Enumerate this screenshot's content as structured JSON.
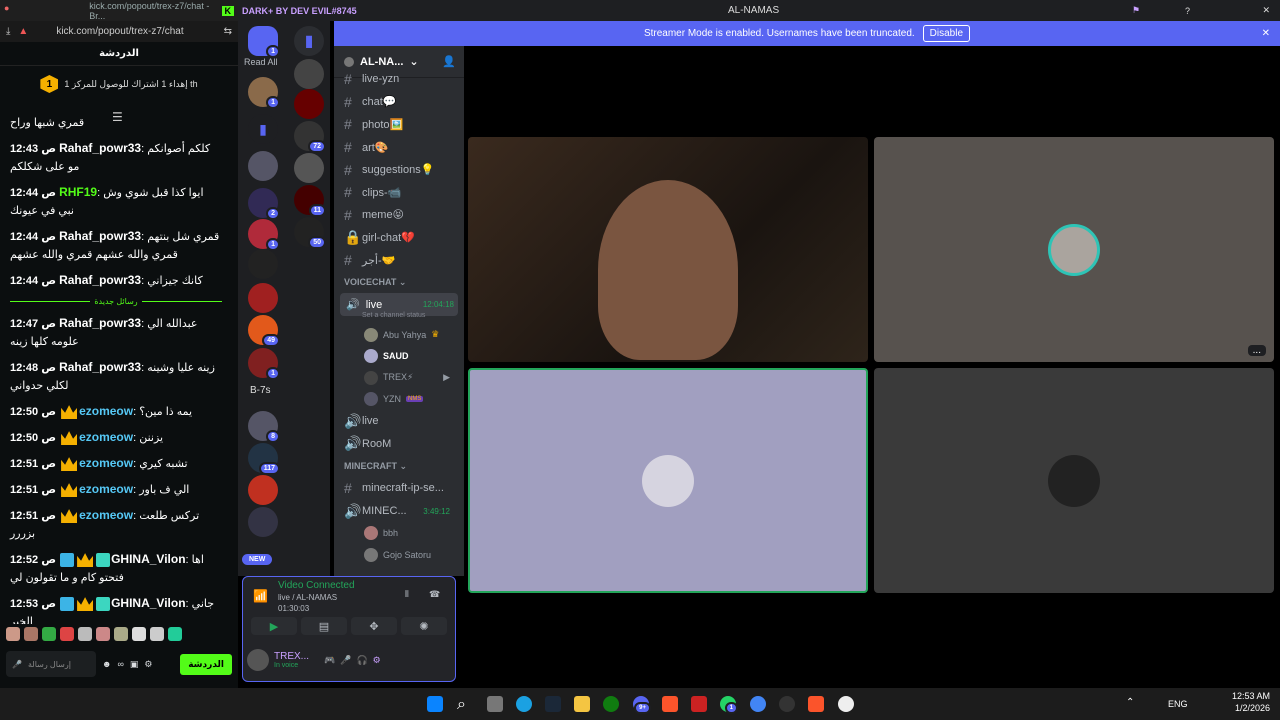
{
  "kick": {
    "url": "kick.com/popout/trex-z7/chat",
    "tab_title": "kick.com/popout/trex-z7/chat - Br...",
    "header": "الدردشة",
    "goal_badge": "1",
    "goal_text": "إهداء 1 اشتراك للوصول للمركز 1 th",
    "first_line": "قمري شبها وراح",
    "separator": "رسائل جديدة",
    "messages": [
      {
        "time": "12:43 ص",
        "user": "Rahaf_powr33",
        "color": "#ffffff",
        "text": "كلكم أصوانكم مو على شكلكم"
      },
      {
        "time": "12:44 ص",
        "user": "RHF19",
        "color": "#53fc18",
        "text": "ايوا كذا قبل شوي وش نبي في عيونك"
      },
      {
        "time": "12:44 ص",
        "user": "Rahaf_powr33",
        "color": "#ffffff",
        "text": "قمري شل بنتهم قمري والله عشهم قمري والله عشهم"
      },
      {
        "time": "12:44 ص",
        "user": "Rahaf_powr33",
        "color": "#ffffff",
        "text": "كانك جيزاني"
      }
    ],
    "messages2": [
      {
        "time": "12:47 ص",
        "user": "Rahaf_powr33",
        "color": "#ffffff",
        "text": "عبدالله الي علومه كلها زينه"
      },
      {
        "time": "12:48 ص",
        "user": "Rahaf_powr33",
        "color": "#ffffff",
        "text": "زينه عليا وشينه لكلي حدواني"
      },
      {
        "time": "12:50 ص",
        "user": "ezomeow",
        "color": "#56c8f5",
        "text": "يمه ذا مين؟"
      },
      {
        "time": "12:50 ص",
        "user": "ezomeow",
        "color": "#56c8f5",
        "text": "يزننن"
      },
      {
        "time": "12:51 ص",
        "user": "ezomeow",
        "color": "#56c8f5",
        "text": "تشبه كيري"
      },
      {
        "time": "12:51 ص",
        "user": "ezomeow",
        "color": "#56c8f5",
        "text": "الي ف باور"
      },
      {
        "time": "12:51 ص",
        "user": "ezomeow",
        "color": "#56c8f5",
        "text": "تركس طلعت بزررر"
      },
      {
        "time": "12:52 ص",
        "user": "GHINA_Vilon",
        "color": "#ffffff",
        "text": "اها فتحتو كام و ما تقولون لي"
      },
      {
        "time": "12:53 ص",
        "user": "GHINA_Vilon",
        "color": "#ffffff",
        "text": "جاني الخبر"
      }
    ],
    "input_placeholder": "إرسال رسالة",
    "send_label": "الدردشة"
  },
  "discord": {
    "brand": "DARK+ BY DEV EVIL#8745",
    "window_title": "AL-NAMAS",
    "read_all": "Read All",
    "banner_text": "Streamer Mode is enabled. Usernames have been truncated.",
    "banner_button": "Disable",
    "server_name": "AL-NA...",
    "text_channels": [
      {
        "name": "live-yzn"
      },
      {
        "name": "chat💬"
      },
      {
        "name": "photo🖼️"
      },
      {
        "name": "art🎨"
      },
      {
        "name": "suggestions💡"
      },
      {
        "name": "clips-📹"
      },
      {
        "name": "meme😝"
      },
      {
        "name": "girl-chat💔"
      },
      {
        "name": "أجر-🤝"
      }
    ],
    "voice_category": "VOICECHAT",
    "voice_channel": "live",
    "voice_time": "12:04:18",
    "voice_status": "Set a channel status",
    "voice_users": [
      "Abu Yahya",
      "SAUD",
      "TREX⚡",
      "YZN"
    ],
    "nms_tag": "NMS",
    "other_voice": [
      "live",
      "RooM"
    ],
    "minecraft_category": "MINECRAFT",
    "minecraft_text": "minecraft-ip-se...",
    "minecraft_voice": "MINEC...",
    "minecraft_time": "3:49:12",
    "minecraft_users": [
      "bbh",
      "Gojo Satoru"
    ],
    "server_badges": [
      "1",
      "1",
      "2",
      "1",
      "49",
      "1",
      "8",
      "117",
      "72",
      "11",
      "50"
    ],
    "b7s": "B-7s",
    "new_label": "NEW",
    "vc_status": "Video Connected",
    "vc_sub": "live / AL-NAMAS",
    "vc_time": "01:30:03",
    "user_name": "TREX...",
    "user_status": "In voice",
    "more": "..."
  },
  "taskbar": {
    "lang": "ENG",
    "time": "12:53 AM",
    "date": "1/2/2026",
    "badge_discord": "9+",
    "badge_whatsapp": "1"
  }
}
